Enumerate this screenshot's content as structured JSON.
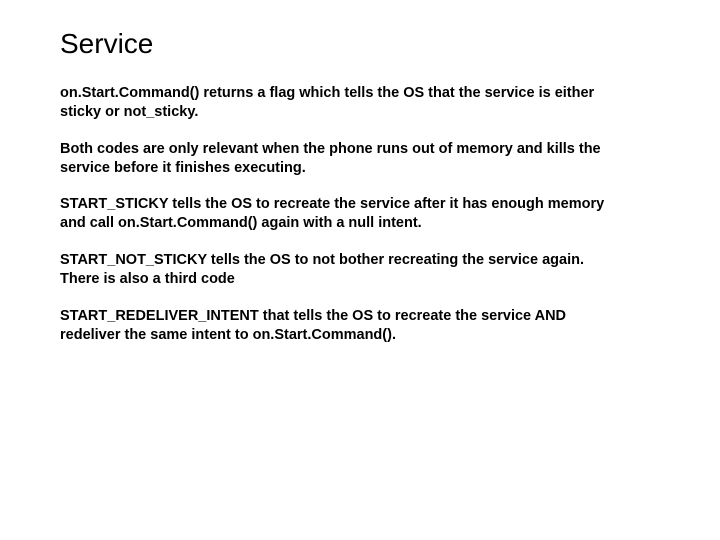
{
  "title": "Service",
  "paragraphs": [
    "on.Start.Command() returns a flag which tells the OS that the service is either sticky or not_sticky.",
    "Both codes are only relevant when the phone runs out of memory and kills the service before it finishes executing.",
    "START_STICKY tells the OS to recreate the service after it has enough memory and call on.Start.Command() again with a null intent.",
    "START_NOT_STICKY tells the OS to not bother recreating the service again. There is also a third code",
    "START_REDELIVER_INTENT that tells the OS to recreate the service AND redeliver the same intent to on.Start.Command()."
  ]
}
